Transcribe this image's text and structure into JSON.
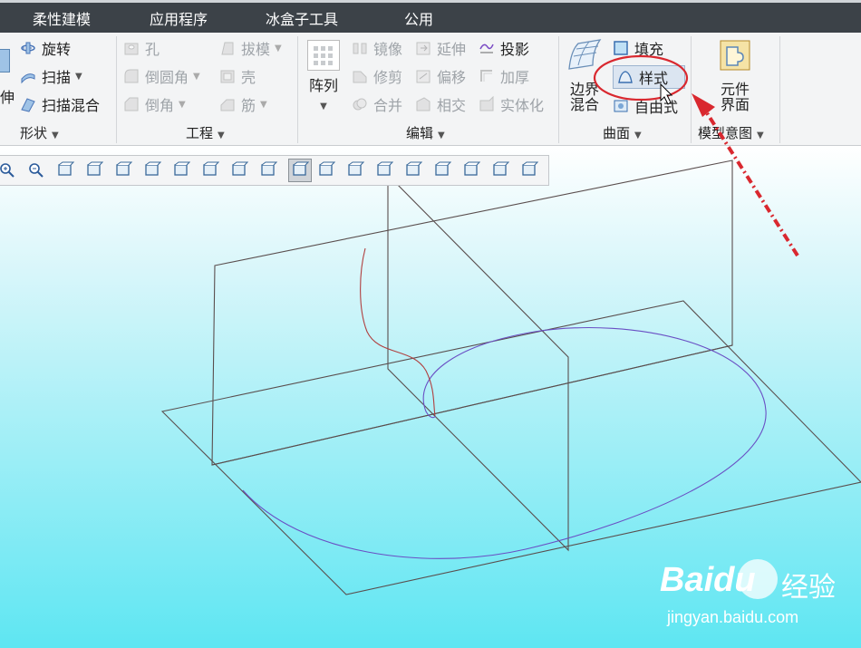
{
  "menubar": {
    "items": [
      {
        "label": "柔性建模"
      },
      {
        "label": "应用程序"
      },
      {
        "label": "冰盒子工具"
      },
      {
        "label": "公用"
      }
    ]
  },
  "ribbon": {
    "shape": {
      "label": "形状",
      "partial_label": "伸",
      "revolve": "旋转",
      "sweep": "扫描",
      "swept_blend": "扫描混合"
    },
    "engineering": {
      "label": "工程",
      "hole": "孔",
      "draft": "拔模",
      "round": "倒圆角",
      "shell": "壳",
      "chamfer": "倒角",
      "rib": "筋"
    },
    "editing": {
      "label": "编辑",
      "pattern": "阵列",
      "mirror": "镜像",
      "extend": "延伸",
      "project": "投影",
      "trim": "修剪",
      "offset": "偏移",
      "thicken": "加厚",
      "merge": "合并",
      "intersect": "相交",
      "solidify": "实体化"
    },
    "surfaces": {
      "label": "曲面",
      "boundary_blend": [
        "边界",
        "混合"
      ],
      "fill": "填充",
      "style": "样式",
      "freestyle": "自由式"
    },
    "model_intent": {
      "label": "模型意图",
      "component_interface": [
        "元件",
        "界面"
      ]
    }
  },
  "view_toolbar": {
    "icons": [
      "zoom-in-icon",
      "zoom-out-icon",
      "refit-icon",
      "repaint-icon",
      "display-style-icon",
      "saved-orientations-icon",
      "view-manager-icon",
      "perspective-icon",
      "spin-center-icon",
      "named-views-icon",
      "annotation-display-icon",
      "plane-display-icon",
      "axis-display-icon",
      "point-display-icon",
      "csys-display-icon",
      "model-tree-display-icon",
      "sketch-display-icon",
      "appearance-icon",
      "section-icon"
    ],
    "selected_index": 10
  },
  "watermark": {
    "brand": "Baidu",
    "brand_cn": "经验",
    "url": "jingyan.baidu.com"
  },
  "colors": {
    "menubar_bg": "#3c4248",
    "ribbon_bg": "#f3f4f5",
    "highlight_ellipse": "#d9282f",
    "arrow": "#d9282f",
    "curve_purple": "#6a4fc4",
    "curve_red": "#b04040",
    "datum_plane": "#5a4e4e"
  }
}
